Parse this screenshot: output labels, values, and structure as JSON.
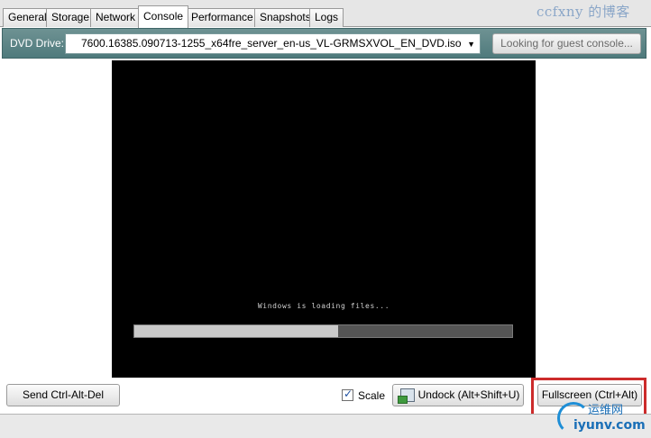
{
  "tabs": [
    {
      "label": "General"
    },
    {
      "label": "Storage"
    },
    {
      "label": "Network"
    },
    {
      "label": "Console",
      "active": true
    },
    {
      "label": "Performance"
    },
    {
      "label": "Snapshots"
    },
    {
      "label": "Logs"
    }
  ],
  "dvd": {
    "label": "DVD Drive:",
    "selected": "7600.16385.090713-1255_x64fre_server_en-us_VL-GRMSXVOL_EN_DVD.iso",
    "guest_button": "Looking for guest console..."
  },
  "console": {
    "loading_text": "Windows is loading files...",
    "progress": 0.54
  },
  "controls": {
    "send_cad": "Send Ctrl-Alt-Del",
    "scale_label": "Scale",
    "scale_checked": true,
    "undock": "Undock (Alt+Shift+U)",
    "fullscreen": "Fullscreen (Ctrl+Alt)"
  },
  "watermarks": {
    "top_right": "ccfxny 的博客",
    "logo_cn": "运维网",
    "logo_url": "iyunv.com"
  },
  "colors": {
    "dvd_bar": "#5a8486",
    "highlight": "#cc2b2b"
  },
  "icons": {
    "dropdown": "chevron-down-icon",
    "scale_check": "checkmark-icon",
    "undock": "undock-window-icon"
  }
}
